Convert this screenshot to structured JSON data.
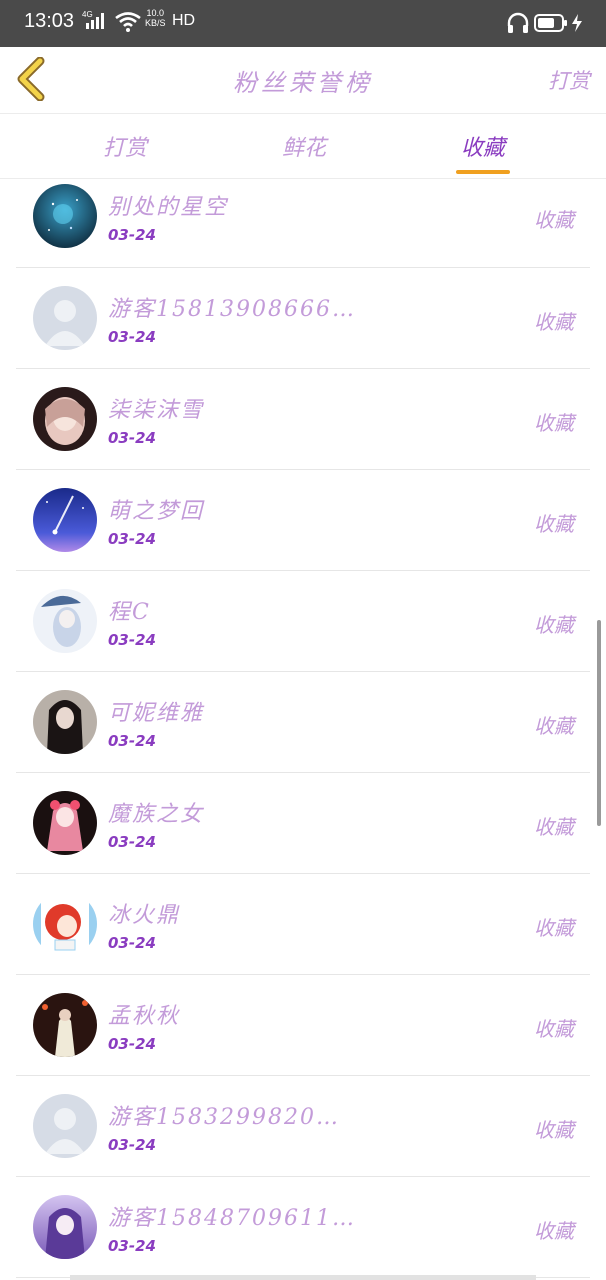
{
  "status_bar": {
    "time": "13:03",
    "network": "4G",
    "speed_value": "10.0",
    "speed_unit": "KB/S",
    "hd": "HD"
  },
  "header": {
    "title": "粉丝荣誉榜",
    "right_link": "打赏"
  },
  "tabs": [
    {
      "label": "打赏",
      "active": false
    },
    {
      "label": "鲜花",
      "active": false
    },
    {
      "label": "收藏",
      "active": true
    }
  ],
  "list": [
    {
      "name": "别处的星空",
      "date": "03-24",
      "action": "收藏",
      "avatar": "night-sky"
    },
    {
      "name": "游客15813908666…",
      "date": "03-24",
      "action": "收藏",
      "avatar": "default-user"
    },
    {
      "name": "柒柒沫雪",
      "date": "03-24",
      "action": "收藏",
      "avatar": "anime-girl"
    },
    {
      "name": "萌之梦回",
      "date": "03-24",
      "action": "收藏",
      "avatar": "meteor-sky"
    },
    {
      "name": "程C",
      "date": "03-24",
      "action": "收藏",
      "avatar": "anime-umbrella"
    },
    {
      "name": "可妮维雅",
      "date": "03-24",
      "action": "收藏",
      "avatar": "dark-hair-girl"
    },
    {
      "name": "魔族之女",
      "date": "03-24",
      "action": "收藏",
      "avatar": "pink-anime"
    },
    {
      "name": "冰火鼎",
      "date": "03-24",
      "action": "收藏",
      "avatar": "red-hair-cartoon"
    },
    {
      "name": "孟秋秋",
      "date": "03-24",
      "action": "收藏",
      "avatar": "lantern-girl"
    },
    {
      "name": "游客1583299820…",
      "date": "03-24",
      "action": "收藏",
      "avatar": "default-user"
    },
    {
      "name": "游客15848709611…",
      "date": "03-24",
      "action": "收藏",
      "avatar": "purple-anime"
    }
  ],
  "colors": {
    "accent_text": "#c39bd9",
    "date_text": "#8a3cc0",
    "tab_indicator": "#f0a020",
    "back_arrow": "#f3d34a"
  }
}
